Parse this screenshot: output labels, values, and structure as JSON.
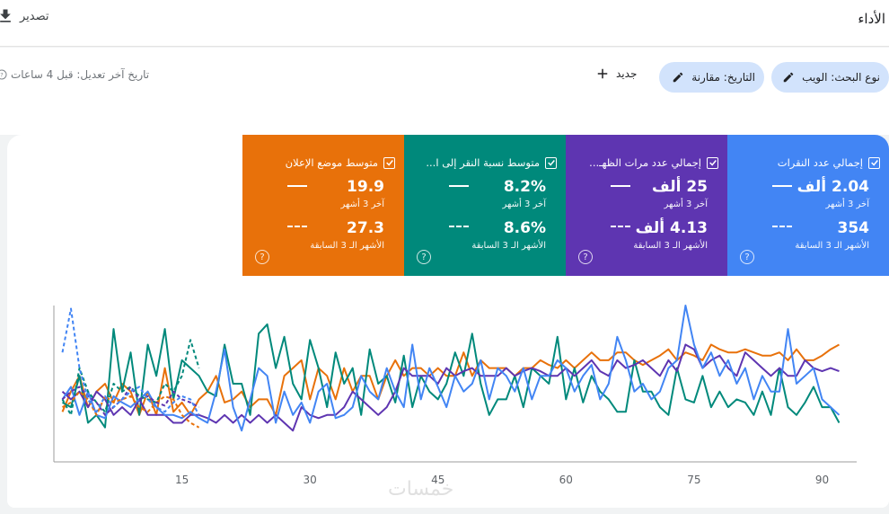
{
  "header": {
    "title": "الأداء",
    "export_label": "تصدير"
  },
  "filters": {
    "search_type": "نوع البحث: الويب",
    "date": "التاريخ: مقارنة",
    "new_label": "جديد",
    "last_updated": "تاريخ آخر تعديل: قبل 4 ساعات"
  },
  "metrics": [
    {
      "name": "إجمالي عدد النقرات",
      "current": "2.04 ألف",
      "current_label": "آخر 3 أشهر",
      "previous": "354",
      "previous_label": "الأشهر الـ 3 السابقة",
      "color": "#4285f4"
    },
    {
      "name": "إجمالي عدد مرات الظهـ...",
      "current": "25 ألف",
      "current_label": "آخر 3 أشهر",
      "previous": "4.13 ألف",
      "previous_label": "الأشهر الـ 3 السابقة",
      "color": "#5e35b1"
    },
    {
      "name": "متوسط نسبة النقر إلى ا...",
      "current": "8.2%",
      "current_label": "آخر 3 أشهر",
      "previous": "8.6%",
      "previous_label": "الأشهر الـ 3 السابقة",
      "color": "#00897b"
    },
    {
      "name": "متوسط موضع الإعلان",
      "current": "19.9",
      "current_label": "آخر 3 أشهر",
      "previous": "27.3",
      "previous_label": "الأشهر الـ 3 السابقة",
      "color": "#e8710a"
    }
  ],
  "chart_data": {
    "type": "line",
    "x_ticks": [
      15,
      30,
      45,
      60,
      75,
      90
    ],
    "xlim": [
      0,
      93
    ],
    "ylim": [
      0,
      100
    ],
    "series": [
      {
        "period": "current",
        "color": "#00897b",
        "values": [
          38,
          35,
          55,
          25,
          30,
          22,
          85,
          45,
          70,
          30,
          75,
          55,
          85,
          40,
          65,
          60,
          55,
          45,
          42,
          75,
          50,
          50,
          30,
          82,
          88,
          60,
          80,
          50,
          40,
          78,
          60,
          35,
          70,
          50,
          60,
          30,
          72,
          50,
          55,
          38,
          68,
          35,
          55,
          45,
          40,
          50,
          70,
          55,
          82,
          50,
          30,
          40,
          40,
          55,
          35,
          60,
          55,
          50,
          80,
          40,
          60,
          38,
          55,
          45,
          40,
          32,
          32,
          65,
          45,
          45,
          35,
          30,
          60,
          40,
          38,
          55,
          35,
          45,
          35,
          40,
          38,
          30,
          45,
          30,
          60,
          35,
          30,
          38,
          48,
          35,
          35,
          25
        ]
      },
      {
        "period": "current",
        "color": "#e8710a",
        "values": [
          32,
          45,
          55,
          35,
          45,
          50,
          38,
          50,
          45,
          30,
          45,
          30,
          60,
          32,
          38,
          30,
          40,
          45,
          55,
          38,
          40,
          45,
          35,
          40,
          40,
          30,
          55,
          60,
          65,
          40,
          60,
          55,
          40,
          60,
          45,
          55,
          55,
          40,
          55,
          65,
          55,
          60,
          60,
          55,
          60,
          55,
          55,
          70,
          55,
          65,
          60,
          60,
          60,
          55,
          60,
          60,
          65,
          62,
          60,
          65,
          60,
          65,
          70,
          65,
          65,
          70,
          70,
          65,
          62,
          65,
          68,
          72,
          65,
          70,
          68,
          65,
          75,
          72,
          70,
          70,
          72,
          70,
          68,
          68,
          70,
          65,
          72,
          65,
          65,
          68,
          72,
          75
        ]
      },
      {
        "period": "current",
        "color": "#5e35b1",
        "values": [
          45,
          40,
          45,
          35,
          45,
          40,
          30,
          35,
          30,
          40,
          30,
          30,
          30,
          25,
          25,
          30,
          30,
          28,
          25,
          30,
          25,
          30,
          25,
          30,
          25,
          30,
          25,
          20,
          35,
          30,
          28,
          30,
          30,
          35,
          45,
          40,
          35,
          30,
          35,
          45,
          60,
          55,
          55,
          55,
          50,
          60,
          55,
          58,
          60,
          55,
          55,
          55,
          60,
          55,
          58,
          60,
          58,
          55,
          55,
          60,
          55,
          60,
          65,
          58,
          55,
          65,
          60,
          62,
          65,
          60,
          55,
          65,
          58,
          75,
          72,
          60,
          65,
          68,
          60,
          55,
          70,
          65,
          60,
          55,
          60,
          55,
          55,
          65,
          60,
          58,
          60,
          58
        ]
      },
      {
        "period": "current",
        "color": "#4285f4",
        "values": [
          40,
          48,
          30,
          45,
          30,
          28,
          42,
          38,
          35,
          40,
          45,
          35,
          30,
          30,
          28,
          32,
          28,
          25,
          45,
          72,
          35,
          20,
          40,
          60,
          55,
          25,
          45,
          30,
          38,
          25,
          45,
          50,
          28,
          30,
          35,
          55,
          45,
          40,
          60,
          45,
          35,
          75,
          40,
          60,
          48,
          35,
          55,
          45,
          50,
          65,
          40,
          60,
          55,
          45,
          60,
          40,
          55,
          55,
          65,
          60,
          45,
          55,
          62,
          40,
          50,
          80,
          65,
          45,
          50,
          40,
          45,
          60,
          65,
          100,
          75,
          60,
          70,
          55,
          65,
          50,
          60,
          40,
          55,
          45,
          45,
          85,
          50,
          55,
          60,
          40,
          35,
          30
        ]
      },
      {
        "period": "previous",
        "color": "#00897b",
        "values": [
          40,
          30,
          60,
          45,
          38,
          32,
          50,
          45,
          48,
          42,
          40,
          38,
          50,
          45,
          55,
          78,
          60
        ]
      },
      {
        "period": "previous",
        "color": "#e8710a",
        "values": [
          35,
          38,
          45,
          40,
          30,
          42,
          38,
          40,
          42,
          35,
          32,
          38,
          42,
          40,
          30,
          25,
          22
        ]
      },
      {
        "period": "previous",
        "color": "#5e35b1",
        "values": [
          40,
          45,
          48,
          42,
          38,
          30,
          35,
          40,
          48,
          40,
          42,
          38,
          36,
          45,
          40,
          38,
          35
        ]
      },
      {
        "period": "previous",
        "color": "#4285f4",
        "values": [
          70,
          98,
          60,
          40,
          32,
          42,
          35,
          40,
          45,
          48,
          40,
          35,
          32,
          38,
          42,
          40,
          30
        ]
      }
    ]
  },
  "watermark": "خمسات"
}
